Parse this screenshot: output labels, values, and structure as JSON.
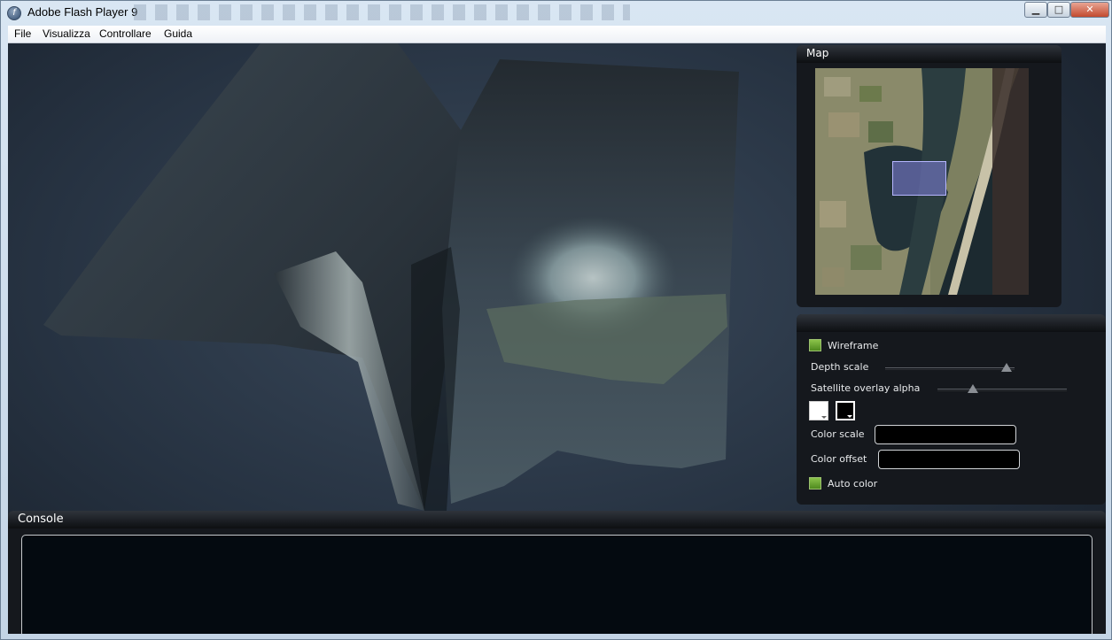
{
  "window": {
    "title": "Adobe Flash Player 9",
    "minimize_glyph": "▁",
    "maximize_glyph": "□",
    "close_glyph": "✕"
  },
  "menubar": {
    "items": [
      "File",
      "Visualizza",
      "Controllare",
      "Guida"
    ]
  },
  "map": {
    "title": "Map"
  },
  "controls": {
    "wireframe_label": "Wireframe",
    "wireframe_checked": true,
    "depth_scale_label": "Depth scale",
    "depth_scale_value": 0.93,
    "satellite_alpha_label": "Satellite overlay alpha",
    "satellite_alpha_value": 0.27,
    "color_scale_label": "Color scale",
    "color_scale_value": "",
    "color_offset_label": "Color offset",
    "color_offset_value": "",
    "auto_color_label": "Auto color",
    "auto_color_checked": true,
    "swatch_low": "#ffffff",
    "swatch_high": "#000000"
  },
  "console": {
    "title": "Console",
    "content": ""
  }
}
